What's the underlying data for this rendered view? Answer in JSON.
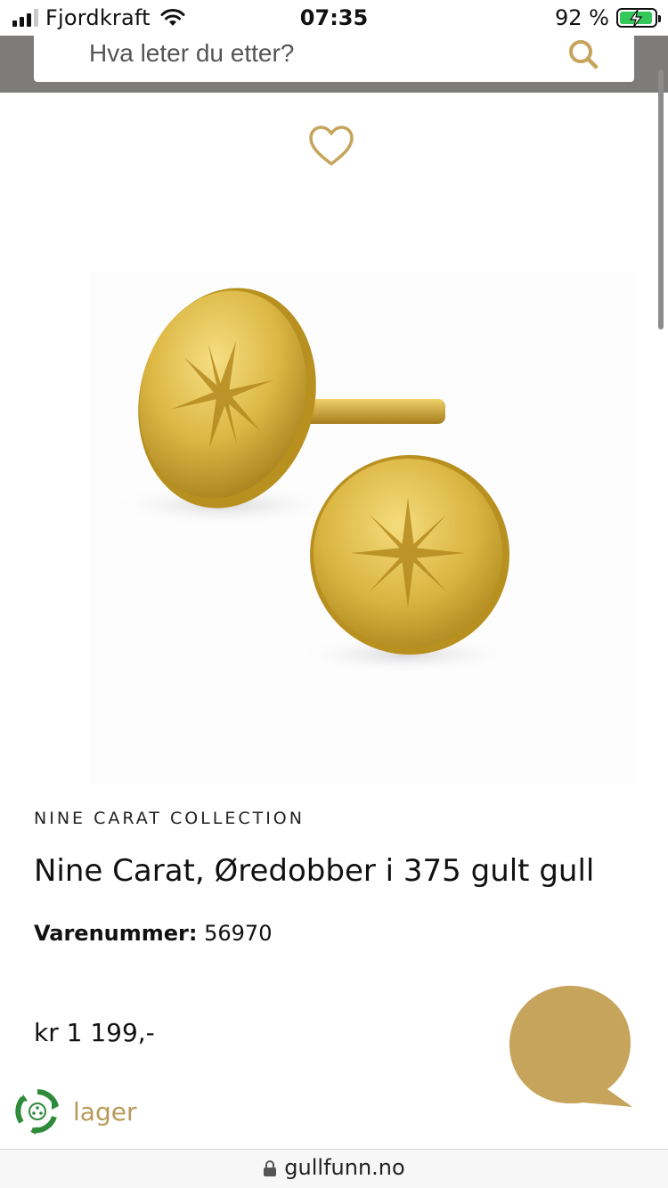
{
  "status_bar": {
    "carrier": "Fjordkraft",
    "time": "07:35",
    "battery_percent": "92 %"
  },
  "search": {
    "placeholder": "Hva leter du etter?"
  },
  "product": {
    "brand": "NINE CARAT COLLECTION",
    "title": "Nine Carat, Øredobber i 375 gult gull",
    "sku_label": "Varenummer:",
    "sku_value": "56970",
    "price": "kr 1 199,-"
  },
  "stock": {
    "label": "lager"
  },
  "browser": {
    "url": "gullfunn.no"
  },
  "colors": {
    "accent_gold": "#c6a45c",
    "header_gray": "#7d7c7a",
    "stock_green": "#2e8b3a"
  },
  "icons": [
    "signal-icon",
    "wifi-icon",
    "battery-icon",
    "search-icon",
    "heart-icon",
    "stock-icon",
    "chat-icon",
    "lock-icon"
  ]
}
